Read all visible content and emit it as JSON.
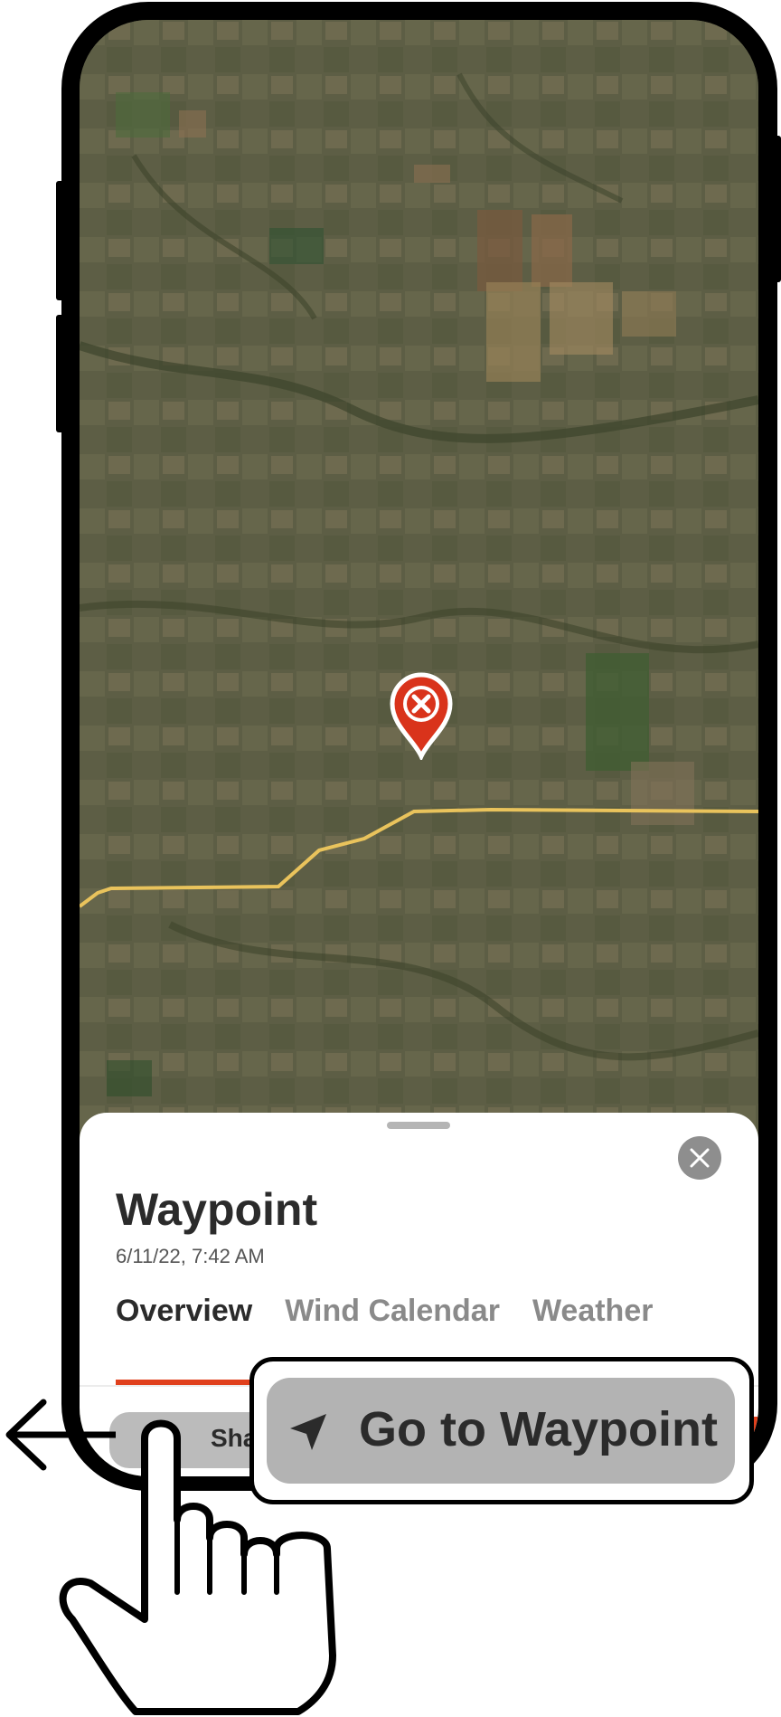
{
  "sheet": {
    "title": "Waypoint",
    "timestamp": "6/11/22, 7:42 AM",
    "close_icon": "close-icon",
    "tabs": [
      {
        "label": "Overview",
        "active": true
      },
      {
        "label": "Wind Calendar",
        "active": false
      },
      {
        "label": "Weather",
        "active": false
      }
    ],
    "accent_color": "#e0401c"
  },
  "actions": {
    "share_label": "Share",
    "goto_label": "Go to Waypoint",
    "goto_icon": "navigation-arrow-icon"
  },
  "map": {
    "marker_icon": "waypoint-marker-icon",
    "route_color": "#e9c35c",
    "imagery": "satellite"
  },
  "overlay": {
    "gesture": "swipe-left",
    "icons": [
      "left-arrow-icon",
      "hand-pointer-icon"
    ]
  }
}
